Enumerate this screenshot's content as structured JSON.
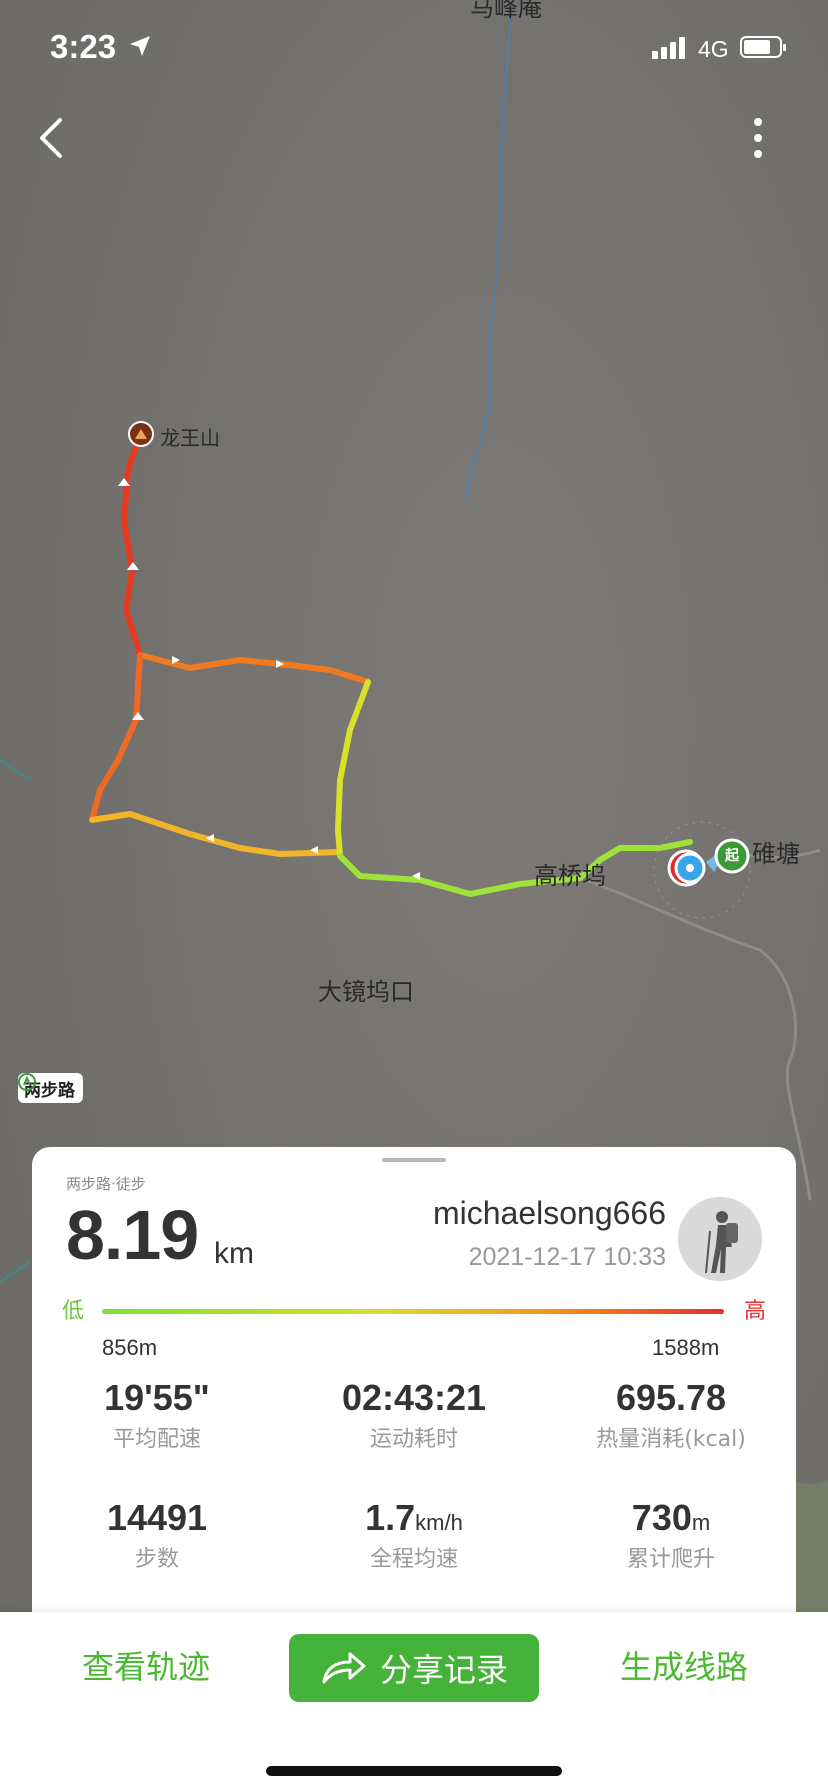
{
  "status_bar": {
    "time": "3:23",
    "network": "4G",
    "battery_level": 0.75
  },
  "map": {
    "labels": {
      "top": "马峰庵",
      "summit": "龙王山",
      "village": "高桥坞",
      "end": "碓塘",
      "south": "大镜坞口"
    },
    "start_marker": "起",
    "brand": "两步路"
  },
  "card": {
    "source": "两步路·徒步",
    "distance": "8.19",
    "distance_unit": "km",
    "username": "michaelsong666",
    "datetime": "2021-12-17 10:33",
    "elevation": {
      "low_label": "低",
      "high_label": "高",
      "min": "856m",
      "max": "1588m"
    },
    "stats": [
      {
        "value": "19'55\"",
        "unit": "",
        "label": "平均配速"
      },
      {
        "value": "02:43:21",
        "unit": "",
        "label": "运动耗时"
      },
      {
        "value": "695.78",
        "unit": "",
        "label": "热量消耗(kcal)"
      },
      {
        "value": "14491",
        "unit": "",
        "label": "步数"
      },
      {
        "value": "1.7",
        "unit": "km/h",
        "label": "全程均速"
      },
      {
        "value": "730",
        "unit": "m",
        "label": "累计爬升"
      }
    ]
  },
  "actions": {
    "view_track": "查看轨迹",
    "share": "分享记录",
    "generate_route": "生成线路"
  },
  "colors": {
    "accent_green": "#45b33a",
    "track_low": "#7ee03c",
    "track_high": "#e52f2a"
  }
}
